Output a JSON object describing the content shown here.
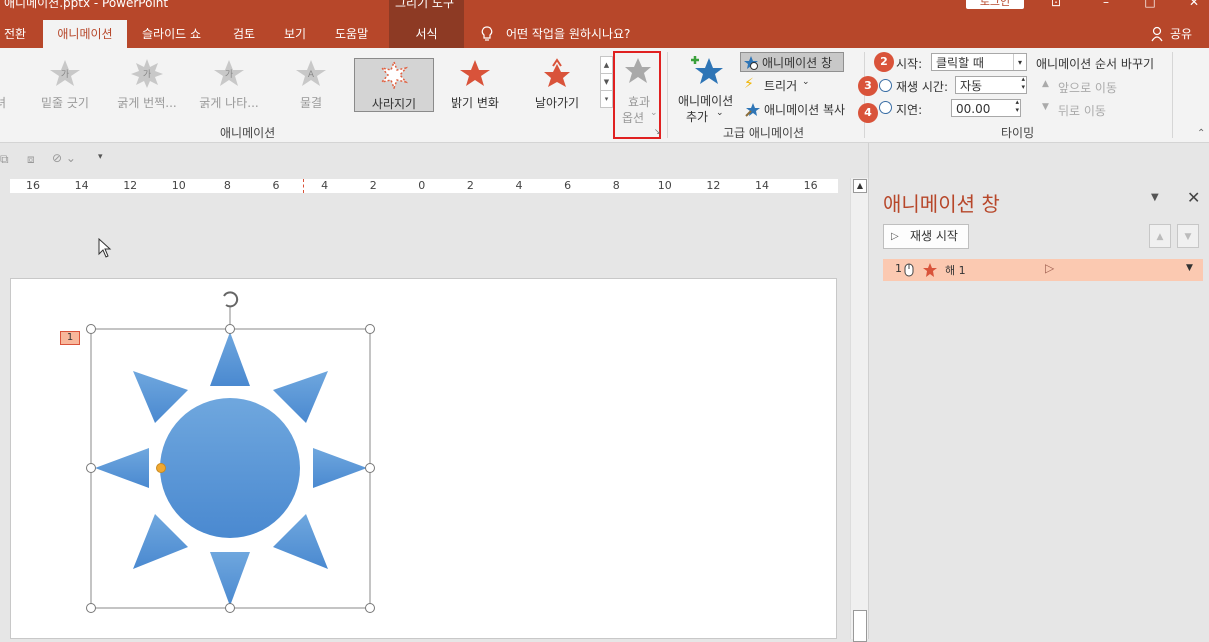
{
  "titlebar": {
    "title": "애니메이션.pptx  -  PowerPoint",
    "context_label": "그리기 도구",
    "login_label": "로그인"
  },
  "tabs": [
    {
      "label": "전환"
    },
    {
      "label": "애니메이션"
    },
    {
      "label": "슬라이드 쇼"
    },
    {
      "label": "검토"
    },
    {
      "label": "보기"
    },
    {
      "label": "도움말"
    },
    {
      "label": "서식"
    }
  ],
  "tell_me": "어떤 작업을 원하시나요?",
  "share_label": "공유",
  "gallery": {
    "items": [
      {
        "label": "밑줄 긋기",
        "glyph": "가"
      },
      {
        "label": "굵게 번쩍...",
        "glyph": "가"
      },
      {
        "label": "굵게 나타...",
        "glyph": "가"
      },
      {
        "label": "물결",
        "glyph": "A"
      },
      {
        "label": "사라지기"
      },
      {
        "label": "밝기 변화"
      },
      {
        "label": "날아가기"
      }
    ],
    "group_label": "애니메이션"
  },
  "effect_options": {
    "line1": "효과",
    "line2": "옵션"
  },
  "advanced": {
    "add_line1": "애니메이션",
    "add_line2": "추가",
    "pane_btn": "애니메이션 창",
    "trigger": "트리거",
    "painter": "애니메이션 복사",
    "group_label": "고급 애니메이션"
  },
  "timing": {
    "start_label": "시작:",
    "start_value": "클릭할 때",
    "duration_label": "재생 시간:",
    "duration_value": "자동",
    "delay_label": "지연:",
    "delay_value": "00.00",
    "reorder_label": "애니메이션 순서 바꾸기",
    "move_earlier": "앞으로 이동",
    "move_later": "뒤로 이동",
    "group_label": "타이밍"
  },
  "badges": [
    "1",
    "2",
    "3",
    "4"
  ],
  "ruler": [
    "16",
    "14",
    "12",
    "10",
    "8",
    "6",
    "4",
    "2",
    "0",
    "2",
    "4",
    "6",
    "8",
    "10",
    "12",
    "14",
    "16"
  ],
  "slide": {
    "anim_tag": "1"
  },
  "pane": {
    "title": "애니메이션 창",
    "play_label": "재생 시작",
    "row_index": "1",
    "row_label": "해 1"
  },
  "colors": {
    "accent": "#b7472a",
    "sun": "#5b9bd5",
    "badge": "#d9533a",
    "row_highlight": "#fbc9b1"
  }
}
